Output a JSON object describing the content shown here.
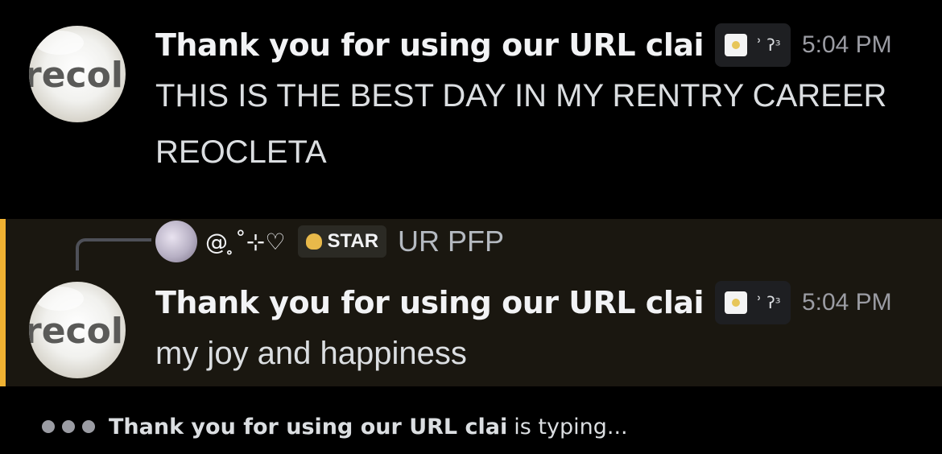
{
  "messages": [
    {
      "avatar_text": "recol",
      "username": "Thank you for using our URL clai",
      "tag_text": "ʾ ʔ​ᶟ",
      "timestamp": "5:04 PM",
      "lines": [
        "THIS IS THE BEST DAY IN MY RENTRY CAREER",
        "REOCLETA"
      ]
    },
    {
      "avatar_text": "recol",
      "username": "Thank you for using our URL clai",
      "tag_text": "ʾ ʔ​ᶟ",
      "timestamp": "5:04 PM",
      "lines": [
        "my joy and happiness"
      ],
      "reply": {
        "author": "@ ̥˚⊹♡",
        "badge": "STAR",
        "content": "UR PFP"
      }
    }
  ],
  "typing": {
    "user": "Thank you for using our URL clai",
    "suffix": "is typing..."
  },
  "colors": {
    "background": "#000000",
    "mention_highlight": "#1a1710",
    "mention_bar": "#f0b232",
    "username": "#f2f3f5",
    "timestamp": "#9b9ca3"
  },
  "icons": {
    "tag_icon": "flower-icon",
    "badge_icon": "flame-icon",
    "typing_icon": "typing-dots-icon"
  }
}
